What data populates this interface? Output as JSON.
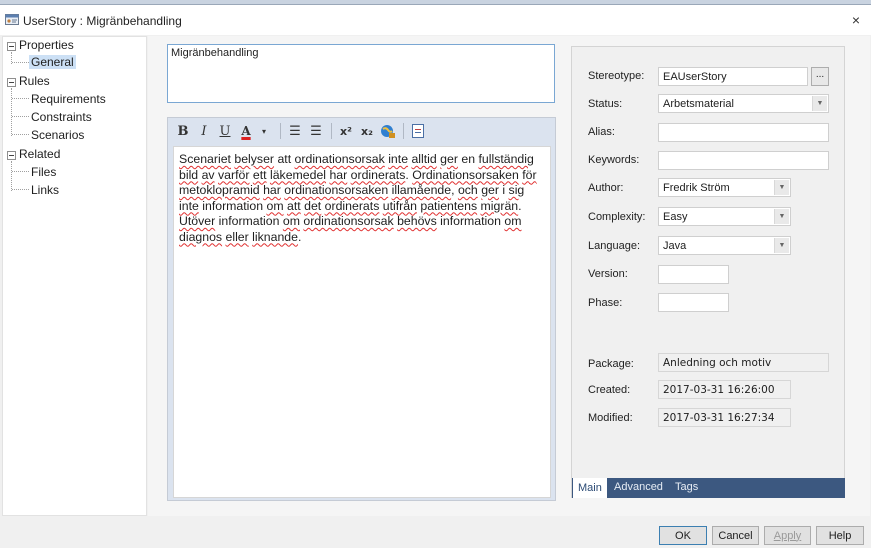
{
  "window": {
    "title": "UserStory : Migränbehandling",
    "close_glyph": "×"
  },
  "tree": {
    "properties": "Properties",
    "general": "General",
    "rules": "Rules",
    "requirements": "Requirements",
    "constraints": "Constraints",
    "scenarios": "Scenarios",
    "related": "Related",
    "files": "Files",
    "links": "Links"
  },
  "name_field": {
    "value": "Migränbehandling"
  },
  "toolbar": {
    "bold": "B",
    "italic": "I",
    "underline": "U",
    "font_color": "A",
    "bullets": "☰",
    "numbering": "☰",
    "superscript": "x²",
    "subscript": "x₂"
  },
  "notes": {
    "p1": [
      [
        "Scenariet",
        1
      ],
      [
        " ",
        0
      ],
      [
        "belyser",
        1
      ],
      [
        " att ",
        0
      ],
      [
        "ordinationsorsak",
        1
      ],
      [
        " ",
        0
      ],
      [
        "inte",
        1
      ],
      [
        " ",
        0
      ],
      [
        "alltid",
        1
      ],
      [
        " ",
        0
      ],
      [
        "ger",
        1
      ],
      [
        " en ",
        0
      ],
      [
        "fullständig",
        1
      ],
      [
        " ",
        0
      ],
      [
        "bild",
        1
      ],
      [
        " ",
        0
      ],
      [
        "av",
        1
      ],
      [
        " ",
        0
      ],
      [
        "varför",
        1
      ],
      [
        " ",
        0
      ],
      [
        "ett",
        1
      ],
      [
        " ",
        0
      ],
      [
        "läkemedel",
        1
      ],
      [
        " ",
        0
      ],
      [
        "har",
        1
      ],
      [
        " ",
        0
      ],
      [
        "ordinerats",
        1
      ],
      [
        ". ",
        0
      ],
      [
        "Ordinationsorsaken",
        1
      ],
      [
        " ",
        0
      ],
      [
        "för",
        1
      ],
      [
        " ",
        0
      ],
      [
        "metoklopramid",
        1
      ],
      [
        " ",
        0
      ],
      [
        "har",
        1
      ],
      [
        " ",
        0
      ],
      [
        "ordinationsorsaken",
        1
      ],
      [
        " ",
        0
      ],
      [
        "illamående",
        1
      ],
      [
        ", ",
        0
      ],
      [
        "och",
        1
      ],
      [
        " ",
        0
      ],
      [
        "ger",
        1
      ],
      [
        " i ",
        0
      ],
      [
        "sig",
        1
      ],
      [
        " ",
        0
      ],
      [
        "inte",
        1
      ],
      [
        " information ",
        0
      ],
      [
        "om",
        1
      ],
      [
        " ",
        0
      ],
      [
        "att",
        1
      ],
      [
        " ",
        0
      ],
      [
        "det",
        1
      ],
      [
        " ",
        0
      ],
      [
        "ordinerats",
        1
      ],
      [
        " ",
        0
      ],
      [
        "utifrån",
        1
      ],
      [
        " ",
        0
      ],
      [
        "patientens",
        1
      ],
      [
        " ",
        0
      ],
      [
        "migrän",
        1
      ],
      [
        ".",
        0
      ]
    ],
    "p2": [
      [
        "Utöver",
        1
      ],
      [
        " information ",
        0
      ],
      [
        "om",
        1
      ],
      [
        " ",
        0
      ],
      [
        "ordinationsorsak",
        1
      ],
      [
        " ",
        0
      ],
      [
        "behövs",
        1
      ],
      [
        " information ",
        0
      ],
      [
        "om",
        1
      ],
      [
        " ",
        0
      ],
      [
        "diagnos",
        1
      ],
      [
        " ",
        0
      ],
      [
        "eller",
        1
      ],
      [
        " ",
        0
      ],
      [
        "liknande",
        1
      ],
      [
        ".",
        0
      ]
    ]
  },
  "props": {
    "stereotype_label": "Stereotype:",
    "stereotype_value": "EAUserStory",
    "ellipsis": "...",
    "status_label": "Status:",
    "status_value": "Arbetsmaterial",
    "alias_label": "Alias:",
    "alias_value": "",
    "keywords_label": "Keywords:",
    "keywords_value": "",
    "author_label": "Author:",
    "author_value": "Fredrik Ström",
    "complexity_label": "Complexity:",
    "complexity_value": "Easy",
    "language_label": "Language:",
    "language_value": "Java",
    "version_label": "Version:",
    "version_value": "",
    "phase_label": "Phase:",
    "phase_value": "",
    "package_label": "Package:",
    "package_value": "Anledning och motiv",
    "created_label": "Created:",
    "created_value": "2017-03-31 16:26:00",
    "modified_label": "Modified:",
    "modified_value": "2017-03-31 16:27:34"
  },
  "tabs": {
    "main": "Main",
    "advanced": "Advanced",
    "tags": "Tags"
  },
  "buttons": {
    "ok": "OK",
    "cancel": "Cancel",
    "apply": "Apply",
    "help": "Help"
  },
  "colors": {
    "tab_bar": "#3c5880",
    "selection": "#cce0f5",
    "spell_error": "#e03030"
  }
}
